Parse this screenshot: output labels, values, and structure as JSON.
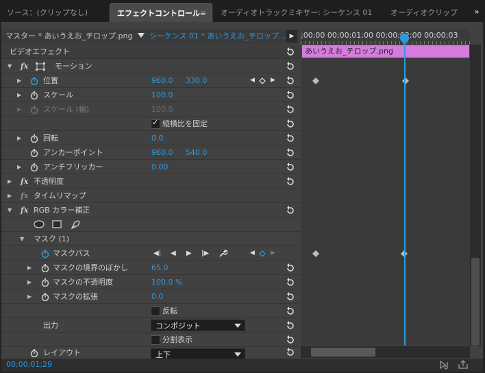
{
  "tabs": [
    {
      "label": "ソース：(クリップなし)"
    },
    {
      "label": "エフェクトコントロール"
    },
    {
      "label": "オーディオトラックミキサー: シーケンス 01"
    },
    {
      "label": "オーディオクリップミキサー"
    }
  ],
  "header": {
    "master": "マスター * あいうえお_テロップ.png",
    "sequence": "シーケンス 01 * あいうえお_テロップ..."
  },
  "timeline": {
    "ruler": ";00;00  00;00;01;00  00;00;02;00  00;00;03",
    "clip_name": "あいうえお_テロップ.png"
  },
  "section_title": "ビデオエフェクト",
  "motion": {
    "title": "モーション",
    "position_label": "位置",
    "position_x": "960.0",
    "position_y": "330.0",
    "scale_label": "スケール",
    "scale_value": "100.0",
    "scale_width_label": "スケール (幅)",
    "scale_width_value": "100.0",
    "uniform_label": "縦横比を固定",
    "rotation_label": "回転",
    "rotation_value": "0.0",
    "anchor_label": "アンカーポイント",
    "anchor_x": "960.0",
    "anchor_y": "540.0",
    "antiflicker_label": "アンチフリッカー",
    "antiflicker_value": "0.00"
  },
  "opacity_title": "不透明度",
  "timeremap_title": "タイムリマップ",
  "rgb": {
    "title": "RGB カラー補正",
    "mask_title": "マスク (1)",
    "mask_path_label": "マスクパス",
    "feather_label": "マスクの境界のぼかし",
    "feather_value": "65.0",
    "mask_opacity_label": "マスクの不透明度",
    "mask_opacity_value": "100.0 %",
    "expansion_label": "マスクの拡張",
    "expansion_value": "0.0",
    "invert_label": "反転",
    "output_label": "出力",
    "output_value": "コンポジット",
    "split_label": "分割表示",
    "layout_label": "レイアウト",
    "layout_value": "上下"
  },
  "timecode": "00;00;01;29"
}
